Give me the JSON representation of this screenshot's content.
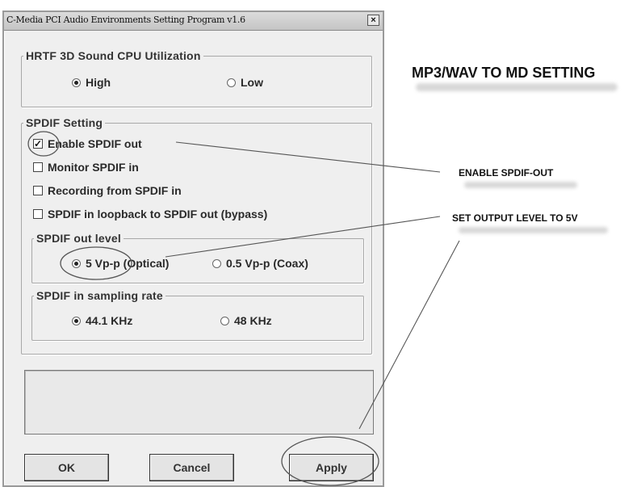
{
  "window": {
    "title": "C-Media PCI Audio Environments Setting Program v1.6",
    "close_label": "×"
  },
  "hrtf": {
    "legend": "HRTF 3D Sound CPU Utilization",
    "options": [
      {
        "label": "High",
        "selected": true
      },
      {
        "label": "Low",
        "selected": false
      }
    ]
  },
  "spdif": {
    "legend": "SPDIF Setting",
    "checkboxes": [
      {
        "label": "Enable SPDIF out",
        "checked": true
      },
      {
        "label": "Monitor SPDIF in",
        "checked": false
      },
      {
        "label": "Recording from SPDIF in",
        "checked": false
      },
      {
        "label": "SPDIF in loopback to SPDIF out (bypass)",
        "checked": false
      }
    ],
    "out_level": {
      "legend": "SPDIF out level",
      "options": [
        {
          "label": "5 Vp-p (Optical)",
          "selected": true
        },
        {
          "label": "0.5 Vp-p (Coax)",
          "selected": false
        }
      ]
    },
    "sampling": {
      "legend": "SPDIF in sampling rate",
      "options": [
        {
          "label": "44.1 KHz",
          "selected": true
        },
        {
          "label": "48 KHz",
          "selected": false
        }
      ]
    }
  },
  "buttons": {
    "ok": "OK",
    "cancel": "Cancel",
    "apply": "Apply"
  },
  "annotations": {
    "heading": "MP3/WAV TO MD SETTING",
    "enable": "ENABLE SPDIF-OUT",
    "level": "SET OUTPUT LEVEL TO 5V"
  },
  "colors": {
    "dialog_bg": "#efefef",
    "annotation_line": "#555555"
  }
}
